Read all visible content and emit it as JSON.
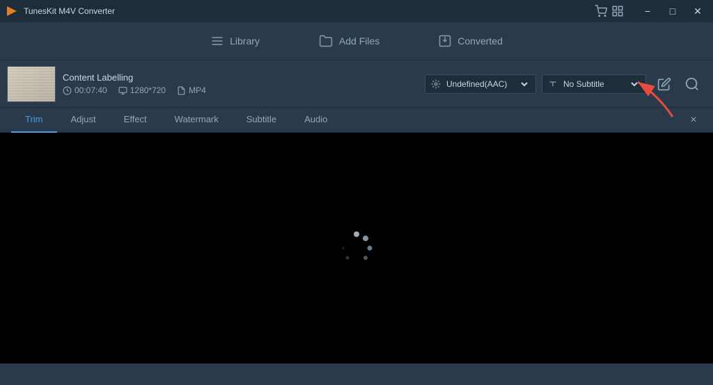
{
  "app": {
    "title": "TunesKit M4V Converter",
    "logo_char": "▶"
  },
  "titlebar": {
    "controls": {
      "cart_icon": "🛒",
      "grid_icon": "⊞",
      "minimize": "−",
      "maximize": "□",
      "close": "✕"
    }
  },
  "nav": {
    "items": [
      {
        "id": "library",
        "label": "Library",
        "icon": "list"
      },
      {
        "id": "add-files",
        "label": "Add Files",
        "icon": "folder"
      },
      {
        "id": "converted",
        "label": "Converted",
        "icon": "export"
      }
    ]
  },
  "file": {
    "name": "Content Labelling",
    "duration": "00:07:40",
    "resolution": "1280*720",
    "format": "MP4",
    "audio": "Undefined(AAC)",
    "subtitle": "No Subtitle",
    "thumbnail_alt": "video thumbnail"
  },
  "edit_panel": {
    "close_label": "×",
    "tabs": [
      {
        "id": "trim",
        "label": "Trim",
        "active": true
      },
      {
        "id": "adjust",
        "label": "Adjust",
        "active": false
      },
      {
        "id": "effect",
        "label": "Effect",
        "active": false
      },
      {
        "id": "watermark",
        "label": "Watermark",
        "active": false
      },
      {
        "id": "subtitle",
        "label": "Subtitle",
        "active": false
      },
      {
        "id": "audio",
        "label": "Audio",
        "active": false
      }
    ]
  },
  "spinner": {
    "dots": [
      {
        "angle": 0,
        "opacity": 1.0,
        "size": 7
      },
      {
        "angle": 40,
        "opacity": 0.9,
        "size": 7
      },
      {
        "angle": 80,
        "opacity": 0.7,
        "size": 6
      },
      {
        "angle": 120,
        "opacity": 0.5,
        "size": 5
      },
      {
        "angle": 200,
        "opacity": 0.3,
        "size": 4
      },
      {
        "angle": 280,
        "opacity": 0.15,
        "size": 3
      }
    ]
  },
  "colors": {
    "accent_blue": "#4a9edd",
    "bg_dark": "#1e2d3a",
    "bg_main": "#2b3a4a",
    "bg_panel": "#253545",
    "text_primary": "#cdd6e0",
    "text_muted": "#8fa8bc",
    "arrow_red": "#e74c3c"
  }
}
